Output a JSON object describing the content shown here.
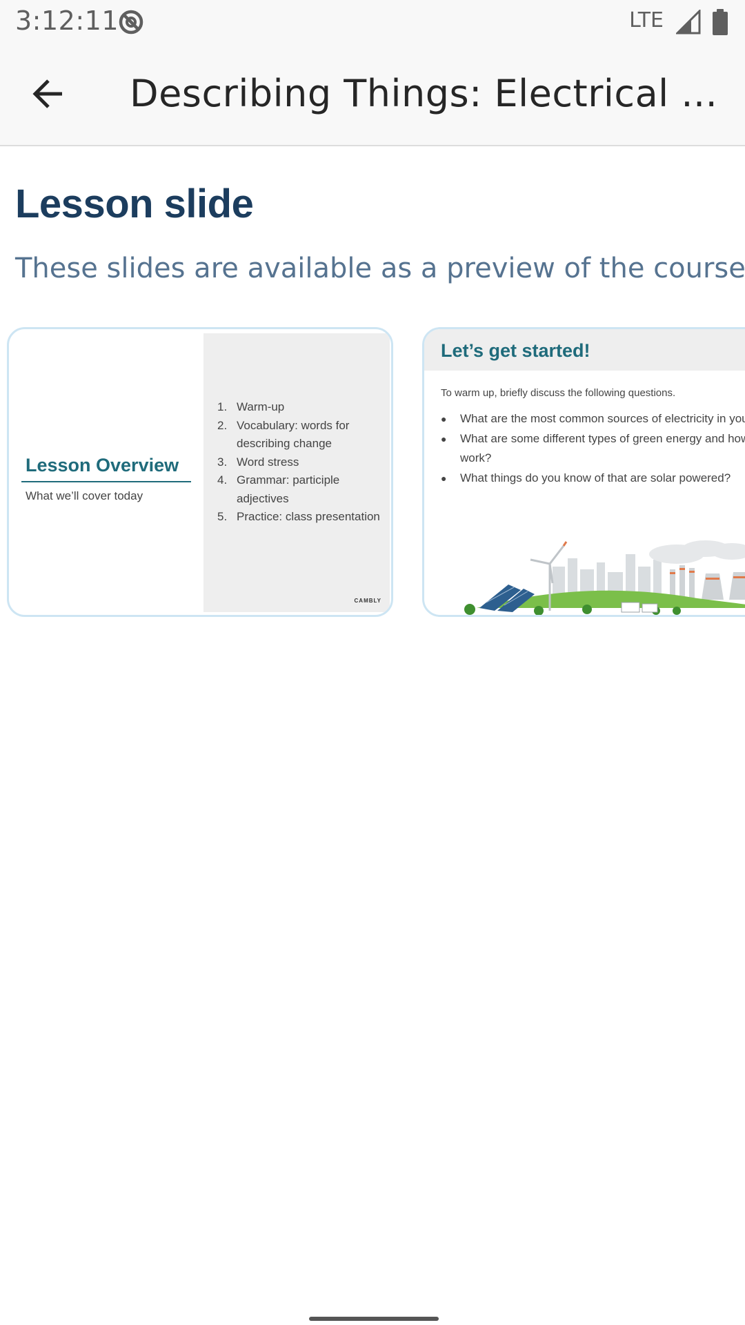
{
  "status_bar": {
    "time": "3:12:11",
    "network": "LTE",
    "icons": [
      "do-not-disturb-icon",
      "signal-icon",
      "battery-icon"
    ]
  },
  "app_bar": {
    "back_icon": "arrow-back-icon",
    "title": "Describing Things: Electrical ..."
  },
  "page": {
    "title": "Lesson slide",
    "subtitle": "These slides are available as a preview of the course"
  },
  "slides": [
    {
      "title": "Lesson Overview",
      "subtitle": "What we’ll cover today",
      "items": [
        {
          "num": "1.",
          "text": "Warm-up"
        },
        {
          "num": "2.",
          "text": "Vocabulary: words for describing change"
        },
        {
          "num": "3.",
          "text": "Word stress"
        },
        {
          "num": "4.",
          "text": "Grammar: participle adjectives"
        },
        {
          "num": "5.",
          "text": "Practice: class presentation"
        }
      ],
      "brand": "CAMBLY"
    },
    {
      "title": "Let’s get started!",
      "intro": "To warm up, briefly discuss the following questions.",
      "bullets": [
        {
          "dot": "●",
          "text": "What are the most common sources of electricity in your country?"
        },
        {
          "dot": "●",
          "text": "What are some different types of green energy and how do they work?"
        },
        {
          "dot": "●",
          "text": "What things do you know of that are solar powered?"
        }
      ]
    }
  ],
  "colors": {
    "page_title": "#1c3d5e",
    "subtitle": "#567390",
    "slide_accent": "#1f6b7b",
    "slide_border": "#cde5f3"
  }
}
